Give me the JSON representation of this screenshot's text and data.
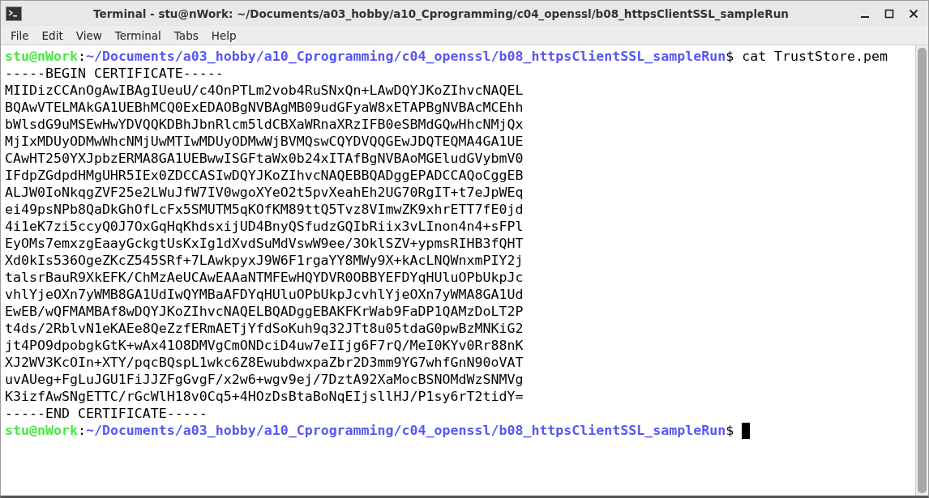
{
  "window": {
    "title": "Terminal - stu@nWork: ~/Documents/a03_hobby/a10_Cprogramming/c04_openssl/b08_httpsClientSSL_sampleRun"
  },
  "menu": [
    "File",
    "Edit",
    "View",
    "Terminal",
    "Tabs",
    "Help"
  ],
  "terminal": {
    "lines": [
      {
        "kind": "prompt",
        "user_host": "stu@nWork",
        "separator": ":",
        "path": "~/Documents/a03_hobby/a10_Cprogramming/c04_openssl/b08_httpsClientSSL_sampleRun",
        "symbol": "$",
        "command": "cat TrustStore.pem"
      },
      {
        "kind": "output",
        "text": "-----BEGIN CERTIFICATE-----"
      },
      {
        "kind": "output",
        "text": "MIIDizCCAnOgAwIBAgIUeuU/c4OnPTLm2vob4RuSNxQn+LAwDQYJKoZIhvcNAQEL"
      },
      {
        "kind": "output",
        "text": "BQAwVTELMAkGA1UEBhMCQ0ExEDAOBgNVBAgMB09udGFyaW8xETAPBgNVBAcMCEhh"
      },
      {
        "kind": "output",
        "text": "bWlsdG9uMSEwHwYDVQQKDBhJbnRlcm5ldCBXaWRnaXRzIFB0eSBMdGQwHhcNMjQx"
      },
      {
        "kind": "output",
        "text": "MjIxMDUyODMwWhcNMjUwMTIwMDUyODMwWjBVMQswCQYDVQQGEwJDQTEQMA4GA1UE"
      },
      {
        "kind": "output",
        "text": "CAwHT250YXJpbzERMA8GA1UEBwwISGFtaWx0b24xITAfBgNVBAoMGEludGVybmV0"
      },
      {
        "kind": "output",
        "text": "IFdpZGdpdHMgUHR5IEx0ZDCCASIwDQYJKoZIhvcNAQEBBQADggEPADCCAQoCggEB"
      },
      {
        "kind": "output",
        "text": "ALJW0IoNkqgZVF25e2LWuJfW7IV0wgoXYeO2t5pvXeahEh2UG70RgIT+t7eJpWEq"
      },
      {
        "kind": "output",
        "text": "ei49psNPb8QaDkGhOfLcFx5SMUTM5qKOfKM89ttQ5Tvz8VImwZK9xhrETT7fE0jd"
      },
      {
        "kind": "output",
        "text": "4i1eK7zi5ccyQ0J7OxGqHqKhdsxijUD4BnyQSfudzGQIbRiix3vLInon4n4+sFPl"
      },
      {
        "kind": "output",
        "text": "EyOMs7emxzgEaayGckgtUsKxIg1dXvdSuMdVswW9ee/3OklSZV+ypmsRIHB3fQHT"
      },
      {
        "kind": "output",
        "text": "Xd0kIs536OgeZKcZ545SRf+7LAwkpyxJ9W6F1rgaYY8MWy9X+kAcLNQWnxmPIY2j"
      },
      {
        "kind": "output",
        "text": "talsrBauR9XkEFK/ChMzAeUCAwEAAaNTMFEwHQYDVR0OBBYEFDYqHUluOPbUkpJc"
      },
      {
        "kind": "output",
        "text": "vhlYjeOXn7yWMB8GA1UdIwQYMBaAFDYqHUluOPbUkpJcvhlYjeOXn7yWMA8GA1Ud"
      },
      {
        "kind": "output",
        "text": "EwEB/wQFMAMBAf8wDQYJKoZIhvcNAQELBQADggEBAKFKrWab9FaDP1QAMzDoLT2P"
      },
      {
        "kind": "output",
        "text": "t4ds/2RblvN1eKAEe8QeZzfERmAETjYfdSoKuh9q32JTt8u05tdaG0pwBzMNKiG2"
      },
      {
        "kind": "output",
        "text": "jt4PO9dpobgkGtK+wAx41O8DMVgCmONDciD4uw7eIIjg6F7rQ/MeI0KYv0Rr88nK"
      },
      {
        "kind": "output",
        "text": "XJ2WV3KcOIn+XTY/pqcBQspL1wkc6Z8EwubdwxpaZbr2D3mm9YG7whfGnN90oVAT"
      },
      {
        "kind": "output",
        "text": "uvAUeg+FgLuJGU1FiJJZFgGvgF/x2w6+wgv9ej/7DztA92XaMocBSNOMdWzSNMVg"
      },
      {
        "kind": "output",
        "text": "K3izfAwSNgETTC/rGcWlH18v0Cq5+4HOzDsBtaBoNqEIjsllHJ/P1sy6rT2tidY="
      },
      {
        "kind": "output",
        "text": "-----END CERTIFICATE-----"
      },
      {
        "kind": "prompt",
        "user_host": "stu@nWork",
        "separator": ":",
        "path": "~/Documents/a03_hobby/a10_Cprogramming/c04_openssl/b08_httpsClientSSL_sampleRun",
        "symbol": "$",
        "cursor": true
      }
    ]
  }
}
